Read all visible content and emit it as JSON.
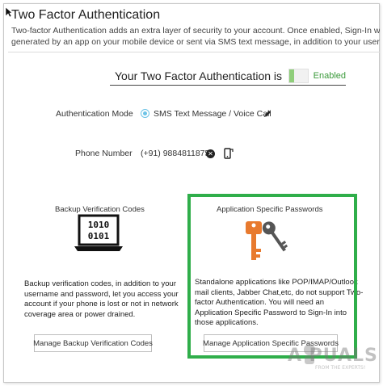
{
  "page": {
    "title": "Two Factor Authentication",
    "description_lines": [
      "Two-factor Authentication adds an extra layer of security to your account. Once enabled, Sign-In will require",
      "generated by an app on your mobile device or sent via SMS text message, in addition to your username and"
    ]
  },
  "status": {
    "text": "Your Two Factor Authentication is",
    "toggle_label": "Enabled",
    "enabled": true
  },
  "auth_mode": {
    "label": "Authentication Mode",
    "value": "SMS Text Message / Voice Call"
  },
  "phone": {
    "label": "Phone Number",
    "value": "(+91) 9884811875"
  },
  "backup": {
    "title": "Backup Verification Codes",
    "laptop_screen_lines": [
      "1010",
      "0101"
    ],
    "text_lines": [
      "Backup verification codes, in addition to your",
      "username and password, let you access your",
      "account if your phone is lost or not in network",
      "coverage area or power drained."
    ],
    "button_label": "Manage Backup Verification Codes"
  },
  "app_passwords": {
    "title": "Application Specific Passwords",
    "text_lines": [
      "Standalone applications like POP/IMAP/Outlook",
      "mail clients, Jabber Chat,etc, do not support Two-",
      "factor Authentication. You will need an",
      "Application Specific Password to Sign-In into",
      "those applications."
    ],
    "button_label": "Manage Application Specific Passwords"
  },
  "watermark": {
    "text": "A  PUALS",
    "sub": "FROM THE EXPERTS!"
  },
  "colors": {
    "highlight": "#2fae4a",
    "toggle_on": "#8fce7a",
    "radio": "#6cc3e6",
    "key_orange": "#e87a2e",
    "key_gray": "#555555"
  }
}
